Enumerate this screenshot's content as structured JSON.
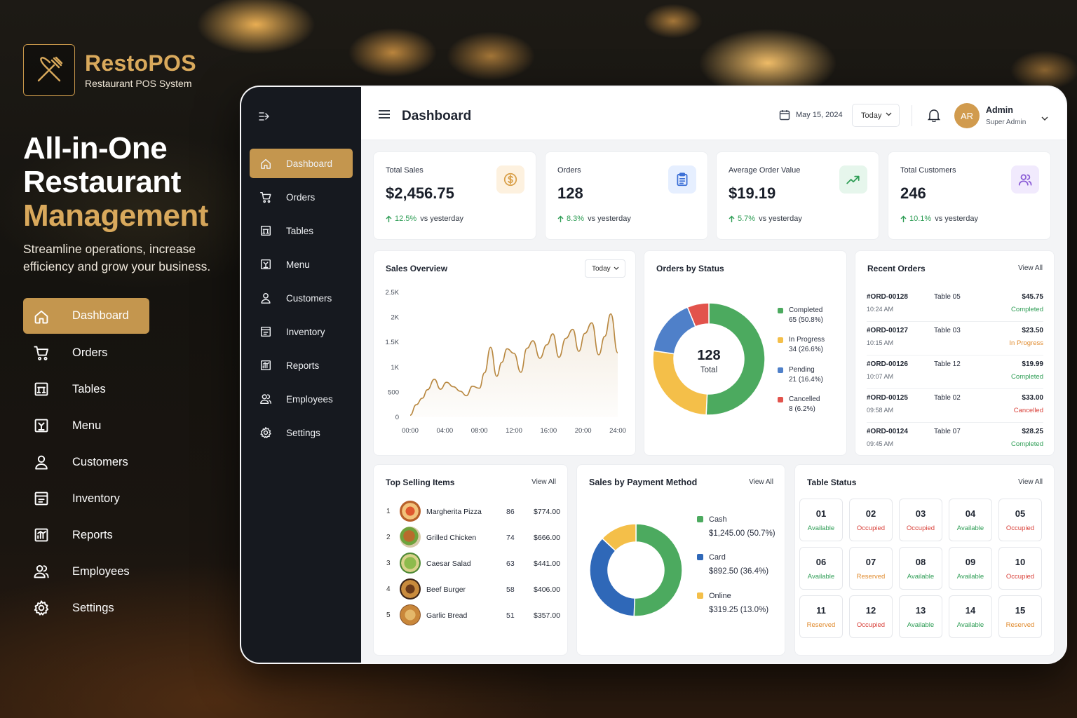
{
  "brand": {
    "name_part1": "Resto",
    "name_part2": "POS",
    "subtitle": "Restaurant POS System"
  },
  "hero": {
    "line1": "All-in-One",
    "line2": "Restaurant",
    "line3": "Management",
    "subtitle": "Streamline operations, increase efficiency and grow your business."
  },
  "nav": [
    {
      "label": "Dashboard",
      "icon": "home-icon"
    },
    {
      "label": "Orders",
      "icon": "cart-icon"
    },
    {
      "label": "Tables",
      "icon": "table-icon"
    },
    {
      "label": "Menu",
      "icon": "menu-book-icon"
    },
    {
      "label": "Customers",
      "icon": "user-icon"
    },
    {
      "label": "Inventory",
      "icon": "inventory-icon"
    },
    {
      "label": "Reports",
      "icon": "reports-icon"
    },
    {
      "label": "Employees",
      "icon": "employees-icon"
    },
    {
      "label": "Settings",
      "icon": "gear-icon"
    }
  ],
  "topbar": {
    "title": "Dashboard",
    "date": "May 15, 2024",
    "range": "Today",
    "user_initials": "AR",
    "user_name": "Admin",
    "user_role": "Super Admin"
  },
  "kpis": [
    {
      "label": "Total Sales",
      "value": "$2,456.75",
      "pct": "12.5%",
      "suffix": "vs yesterday",
      "icon": "dollar-icon",
      "icon_bg": "#fdf1df",
      "icon_color": "#d9a04a"
    },
    {
      "label": "Orders",
      "value": "128",
      "pct": "8.3%",
      "suffix": "vs yesterday",
      "icon": "clipboard-icon",
      "icon_bg": "#e6efff",
      "icon_color": "#3b6fd6"
    },
    {
      "label": "Average Order Value",
      "value": "$19.19",
      "pct": "5.7%",
      "suffix": "vs yesterday",
      "icon": "trend-up-icon",
      "icon_bg": "#e6f6ec",
      "icon_color": "#2e9d55"
    },
    {
      "label": "Total Customers",
      "value": "246",
      "pct": "10.1%",
      "suffix": "vs yesterday",
      "icon": "users-icon",
      "icon_bg": "#f1eafd",
      "icon_color": "#8a5cd6"
    }
  ],
  "sales_overview": {
    "title": "Sales Overview",
    "range": "Today"
  },
  "chart_data": [
    {
      "type": "area",
      "title": "Sales Overview",
      "x_ticks": [
        "00:00",
        "04:00",
        "08:00",
        "12:00",
        "16:00",
        "20:00",
        "24:00"
      ],
      "y_ticks": [
        "0",
        "500",
        "1K",
        "1.5K",
        "2K",
        "2.5K"
      ],
      "ylim": [
        0,
        2500
      ],
      "xlim": [
        0,
        24
      ],
      "color": "#b8873f",
      "x": [
        0,
        0.7,
        1.4,
        2,
        2.8,
        3.5,
        4.2,
        5,
        5.8,
        6.5,
        7.2,
        8,
        8.6,
        9.3,
        10,
        10.6,
        11.2,
        12,
        12.8,
        13.5,
        14.2,
        15,
        15.8,
        16.5,
        17.2,
        18,
        18.8,
        19.5,
        20.2,
        21,
        21.8,
        22.5,
        23.2,
        24
      ],
      "y": [
        40,
        250,
        380,
        550,
        760,
        560,
        700,
        610,
        520,
        430,
        620,
        580,
        890,
        1400,
        820,
        1100,
        1370,
        1280,
        900,
        1380,
        1530,
        1180,
        1450,
        1670,
        1200,
        1580,
        1760,
        1320,
        1680,
        1890,
        1250,
        1620,
        2070,
        1290
      ]
    },
    {
      "type": "pie",
      "title": "Orders by Status",
      "center_value": "128",
      "center_label": "Total",
      "slices": [
        {
          "name": "Completed",
          "value": 65,
          "label": "65 (50.8%)",
          "color": "#4caa5f"
        },
        {
          "name": "In Progress",
          "value": 34,
          "label": "34 (26.6%)",
          "color": "#f4bf49"
        },
        {
          "name": "Pending",
          "value": 21,
          "label": "21 (16.4%)",
          "color": "#4f80c9"
        },
        {
          "name": "Cancelled",
          "value": 8,
          "label": "8 (6.2%)",
          "color": "#e2534c"
        }
      ]
    },
    {
      "type": "pie",
      "title": "Sales by Payment Method",
      "slices": [
        {
          "name": "Cash",
          "value": 1245.0,
          "label": "$1,245.00 (50.7%)",
          "color": "#4caa5f"
        },
        {
          "name": "Card",
          "value": 892.5,
          "label": "$892.50 (36.4%)",
          "color": "#2f68b8"
        },
        {
          "name": "Online",
          "value": 319.25,
          "label": "$319.25 (13.0%)",
          "color": "#f4bf49"
        }
      ]
    }
  ],
  "orders_status": {
    "title": "Orders by Status"
  },
  "recent_orders": {
    "title": "Recent Orders",
    "view_all": "View All",
    "rows": [
      {
        "id": "#ORD-00128",
        "time": "10:24 AM",
        "table": "Table 05",
        "amount": "$45.75",
        "status": "Completed",
        "color": "#2e9d55"
      },
      {
        "id": "#ORD-00127",
        "time": "10:15 AM",
        "table": "Table 03",
        "amount": "$23.50",
        "status": "In Progress",
        "color": "#e08a2c"
      },
      {
        "id": "#ORD-00126",
        "time": "10:07 AM",
        "table": "Table 12",
        "amount": "$19.99",
        "status": "Completed",
        "color": "#2e9d55"
      },
      {
        "id": "#ORD-00125",
        "time": "09:58 AM",
        "table": "Table 02",
        "amount": "$33.00",
        "status": "Cancelled",
        "color": "#d9413a"
      },
      {
        "id": "#ORD-00124",
        "time": "09:45 AM",
        "table": "Table 07",
        "amount": "$28.25",
        "status": "Completed",
        "color": "#2e9d55"
      }
    ]
  },
  "top_selling": {
    "title": "Top Selling Items",
    "view_all": "View All",
    "rows": [
      {
        "rank": "1",
        "name": "Margherita Pizza",
        "qty": "86",
        "amount": "$774.00",
        "img": "pizza-image"
      },
      {
        "rank": "2",
        "name": "Grilled Chicken",
        "qty": "74",
        "amount": "$666.00",
        "img": "chicken-image"
      },
      {
        "rank": "3",
        "name": "Caesar Salad",
        "qty": "63",
        "amount": "$441.00",
        "img": "salad-image"
      },
      {
        "rank": "4",
        "name": "Beef Burger",
        "qty": "58",
        "amount": "$406.00",
        "img": "burger-image"
      },
      {
        "rank": "5",
        "name": "Garlic Bread",
        "qty": "51",
        "amount": "$357.00",
        "img": "bread-image"
      }
    ]
  },
  "payment": {
    "title": "Sales by Payment Method",
    "view_all": "View All"
  },
  "table_status": {
    "title": "Table Status",
    "view_all": "View All",
    "tables": [
      {
        "no": "01",
        "status": "Available"
      },
      {
        "no": "02",
        "status": "Occupied"
      },
      {
        "no": "03",
        "status": "Occupied"
      },
      {
        "no": "04",
        "status": "Available"
      },
      {
        "no": "05",
        "status": "Occupied"
      },
      {
        "no": "06",
        "status": "Available"
      },
      {
        "no": "07",
        "status": "Reserved"
      },
      {
        "no": "08",
        "status": "Available"
      },
      {
        "no": "09",
        "status": "Available"
      },
      {
        "no": "10",
        "status": "Occupied"
      },
      {
        "no": "11",
        "status": "Reserved"
      },
      {
        "no": "12",
        "status": "Occupied"
      },
      {
        "no": "13",
        "status": "Available"
      },
      {
        "no": "14",
        "status": "Available"
      },
      {
        "no": "15",
        "status": "Reserved"
      }
    ],
    "status_colors": {
      "Available": "#2e9d55",
      "Occupied": "#d9413a",
      "Reserved": "#e08a2c"
    }
  },
  "colors": {
    "accent": "#c4964e",
    "sidebar": "#16191f"
  }
}
